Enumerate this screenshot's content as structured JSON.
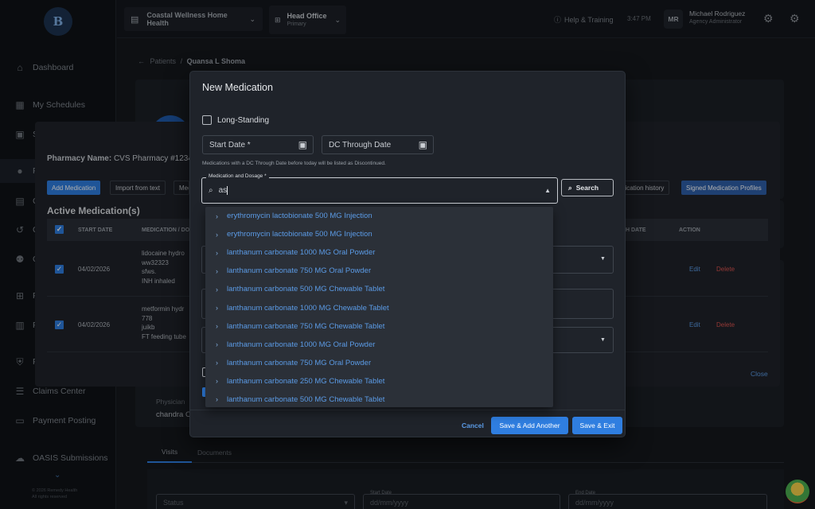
{
  "sidebar": {
    "logo": "B",
    "items": [
      {
        "label": "Dashboard",
        "icon": "home-icon"
      },
      {
        "label": "My Schedules",
        "icon": "calendar-icon"
      },
      {
        "label": "S",
        "icon": "calendar-check-icon"
      },
      {
        "label": "P",
        "icon": "people-icon"
      },
      {
        "label": "C",
        "icon": "clipboard-icon"
      },
      {
        "label": "C",
        "icon": "history-icon"
      },
      {
        "label": "C",
        "icon": "group-icon"
      },
      {
        "label": "P",
        "icon": "plus-square-icon"
      },
      {
        "label": "P",
        "icon": "chart-icon"
      },
      {
        "label": "P",
        "icon": "shield-icon"
      },
      {
        "label": "Claims Center",
        "icon": "list-icon"
      },
      {
        "label": "Payment Posting",
        "icon": "card-icon"
      },
      {
        "label": "OASIS Submissions",
        "icon": "cloud-upload-icon"
      }
    ],
    "footer_line1": "© 2026 Remedy Health",
    "footer_line2": "All rights reserved"
  },
  "topbar": {
    "agency": "Coastal Wellness Home Health",
    "office": "Head Office",
    "office_sub": "Primary",
    "help": "Help & Training",
    "time": "3:47 PM",
    "avatar": "MR",
    "user_name": "Michael Rodriguez",
    "user_role": "Agency Administrator"
  },
  "breadcrumb": {
    "parent": "Patients",
    "separator": "/",
    "current": "Quansa L Shoma"
  },
  "background": {
    "physician_label": "Physician",
    "physician_value": "chandra C",
    "tabs": [
      "Visits",
      "Documents"
    ],
    "status_placeholder": "Status",
    "start_date_label": "Start Date",
    "start_date_placeholder": "dd/mm/yyyy",
    "end_date_label": "End Date",
    "end_date_placeholder": "dd/mm/yyyy"
  },
  "medmodal": {
    "pharmacy_label": "Pharmacy Name:",
    "pharmacy_value": "CVS Pharmacy #1234",
    "buttons": [
      "Add Medication",
      "Import from text",
      "Med"
    ],
    "right_buttons": [
      "dication history",
      "Signed Medication Profiles"
    ],
    "section_title": "Active Medication(s)",
    "columns": [
      "START DATE",
      "MEDICATION / DO",
      "H DATE",
      "ACTION"
    ],
    "rows": [
      {
        "start": "04/02/2026",
        "lines": [
          "lidocaine hydro",
          "ww32323",
          "sfws.",
          "INH inhaled"
        ],
        "edit": "Edit",
        "delete": "Delete"
      },
      {
        "start": "04/02/2026",
        "lines": [
          "metformin hydr",
          "778",
          "juikb",
          "FT feeding tube"
        ],
        "edit": "Edit",
        "delete": "Delete"
      }
    ],
    "close": "Close"
  },
  "dialog": {
    "title": "New Medication",
    "long_standing": "Long-Standing",
    "start_date": "Start Date *",
    "dc_through": "DC Through Date",
    "hint": "Medications with a DC Through Date before today will be listed as Discontinued.",
    "med_label": "Medication and Dosage *",
    "med_value": "as",
    "search_btn": "Search",
    "options": [
      "erythromycin lactobionate 500 MG Injection",
      "erythromycin lactobionate 500 MG Injection",
      "lanthanum carbonate 1000 MG Oral Powder",
      "lanthanum carbonate 750 MG Oral Powder",
      "lanthanum carbonate 500 MG Chewable Tablet",
      "lanthanum carbonate 1000 MG Chewable Tablet",
      "lanthanum carbonate 750 MG Chewable Tablet",
      "lanthanum carbonate 1000 MG Oral Powder",
      "lanthanum carbonate 750 MG Oral Powder",
      "lanthanum carbonate 250 MG Chewable Tablet",
      "lanthanum carbonate 500 MG Chewable Tablet"
    ],
    "cancel": "Cancel",
    "save_another": "Save & Add Another",
    "save_exit": "Save & Exit"
  },
  "colors": {
    "accent": "#2f7ee0",
    "link": "#5b9be6",
    "delete": "#d9534f"
  }
}
